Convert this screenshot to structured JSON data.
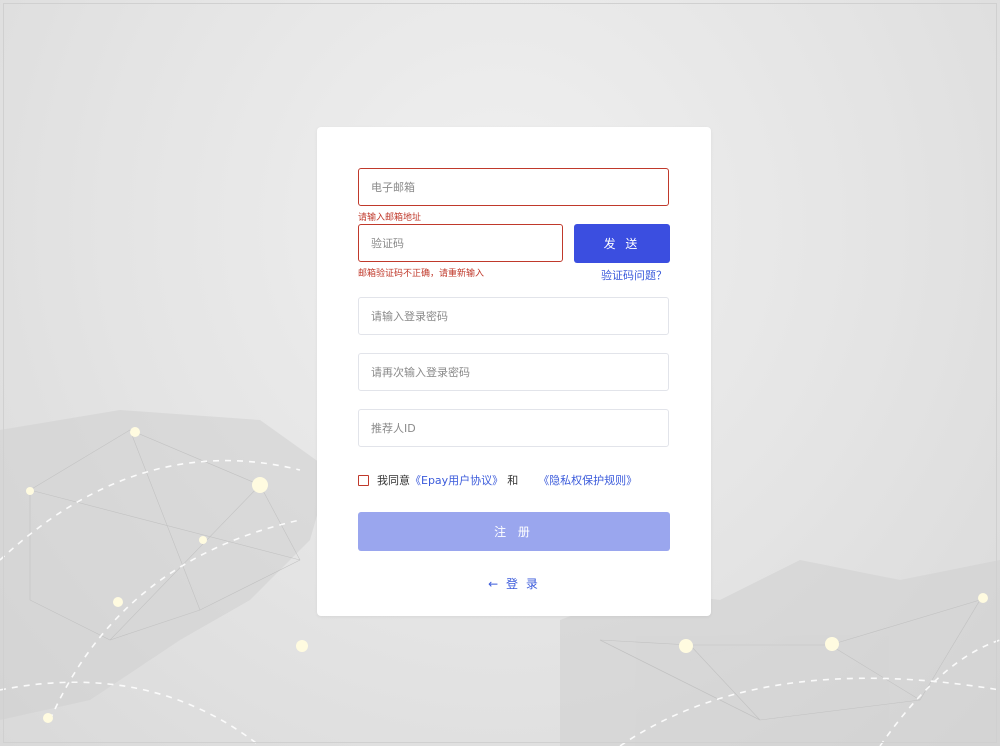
{
  "form": {
    "email_placeholder": "电子邮箱",
    "email_error": "请输入邮箱地址",
    "code_placeholder": "验证码",
    "code_error": "邮箱验证码不正确，请重新输入",
    "send_label": "发 送",
    "code_help_link": "验证码问题？",
    "password_placeholder": "请输入登录密码",
    "password_confirm_placeholder": "请再次输入登录密码",
    "referrer_placeholder": "推荐人ID",
    "agree_text": "我同意",
    "user_agreement_link": "《Epay用户协议》",
    "and_text": "和",
    "privacy_link": "《隐私权保护规则》",
    "register_label": "注 册",
    "login_arrow": "←",
    "login_label": "登 录"
  },
  "colors": {
    "primary": "#3b4ee0",
    "primary_disabled": "#9aa6ee",
    "error": "#c0392b",
    "link": "#3b5bdb"
  }
}
